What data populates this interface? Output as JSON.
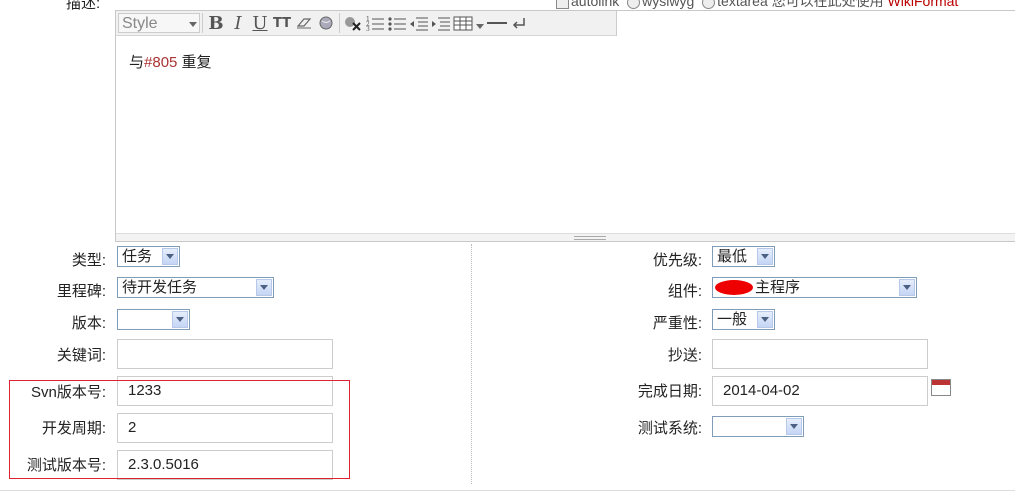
{
  "header": {
    "description_label": "描述:",
    "autolink_label": "autolink",
    "wysiwyg_label": "wysiwyg",
    "textarea_label": "textarea",
    "help_text": "您可以在此处使用",
    "wiki_link": "WikiFormat"
  },
  "editor": {
    "style_placeholder": "Style",
    "content_prefix": "与",
    "content_ref": "#805",
    "content_suffix": " 重复"
  },
  "form": {
    "left": {
      "type": {
        "label": "类型:",
        "value": "任务"
      },
      "milestone": {
        "label": "里程碑:",
        "value": "待开发任务"
      },
      "version": {
        "label": "版本:",
        "value": ""
      },
      "keywords": {
        "label": "关键词:",
        "value": ""
      },
      "svn_version": {
        "label": "Svn版本号:",
        "value": "1233"
      },
      "dev_cycle": {
        "label": "开发周期:",
        "value": "2"
      },
      "test_version": {
        "label": "测试版本号:",
        "value": "2.3.0.5016"
      }
    },
    "right": {
      "priority": {
        "label": "优先级:",
        "value": "最低"
      },
      "component": {
        "label": "组件:",
        "value": "主程序"
      },
      "severity": {
        "label": "严重性:",
        "value": "一般"
      },
      "cc": {
        "label": "抄送:",
        "value": ""
      },
      "due_date": {
        "label": "完成日期:",
        "value": "2014-04-02"
      },
      "test_system": {
        "label": "测试系统:",
        "value": ""
      }
    }
  },
  "colors": {
    "highlight_box": "#d22233",
    "link": "#b00000",
    "ticket_ref": "#a33333"
  }
}
